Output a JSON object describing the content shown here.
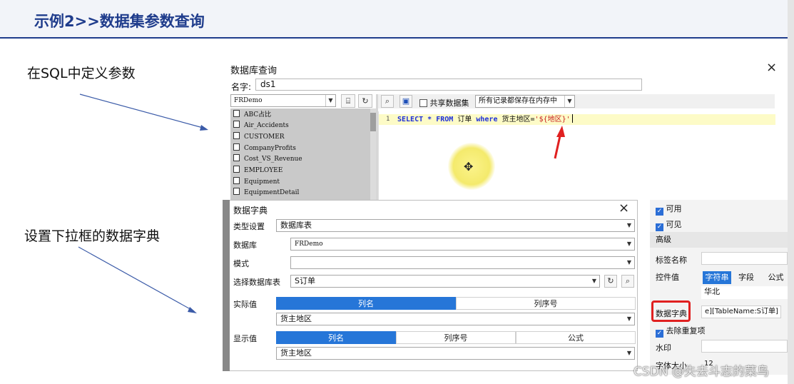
{
  "slide": {
    "title": "示例2>>数据集参数查询",
    "annotation_1": "在SQL中定义参数",
    "annotation_2": "设置下拉框的数据字典",
    "watermark": "CSDN @失去斗志的菜鸟"
  },
  "db_query_window": {
    "title": "数据库查询",
    "close": "×",
    "name_label": "名字:",
    "name_value": "ds1",
    "datasource": "FRDemo",
    "share_dataset_label": "共享数据集",
    "memory_mode": "所有记录都保存在内存中",
    "tables": [
      "ABC占比",
      "Air_Accidents",
      "CUSTOMER",
      "CompanyProfits",
      "Cost_VS_Revenue",
      "EMPLOYEE",
      "Equipment",
      "EquipmentDetail"
    ],
    "sql": {
      "line_number": "1",
      "select": "SELECT",
      "star": "*",
      "from": "FROM",
      "table": "订单",
      "where": "where",
      "field": "货主地区=",
      "param": "'${地区}'"
    }
  },
  "data_dict_window": {
    "title": "数据字典",
    "close": "×",
    "type_label": "类型设置",
    "type_value": "数据库表",
    "db_label": "数据库",
    "db_value": "FRDemo",
    "schema_label": "模式",
    "schema_value": "",
    "table_label": "选择数据库表",
    "table_value": "S订单",
    "actual_label": "实际值",
    "actual_tabs": [
      "列名",
      "列序号"
    ],
    "actual_value": "货主地区",
    "display_label": "显示值",
    "display_tabs": [
      "列名",
      "列序号",
      "公式"
    ],
    "display_value": "货主地区"
  },
  "props_panel": {
    "enabled": "可用",
    "visible": "可见",
    "advanced": "高级",
    "tag_name_label": "标签名称",
    "widget_value_label": "控件值",
    "value_tabs": [
      "字符串",
      "字段",
      "公式"
    ],
    "value": "华北",
    "dict_label": "数据字典",
    "dict_value": "e][TableName:S订单]",
    "dedupe": "去除重复项",
    "watermark_label": "水印",
    "font_size_label": "字体大小",
    "font_size_value": "12"
  },
  "colors": {
    "title_blue": "#1f3c8c",
    "accent_blue": "#2676d8",
    "highlight_red": "#e02020"
  }
}
